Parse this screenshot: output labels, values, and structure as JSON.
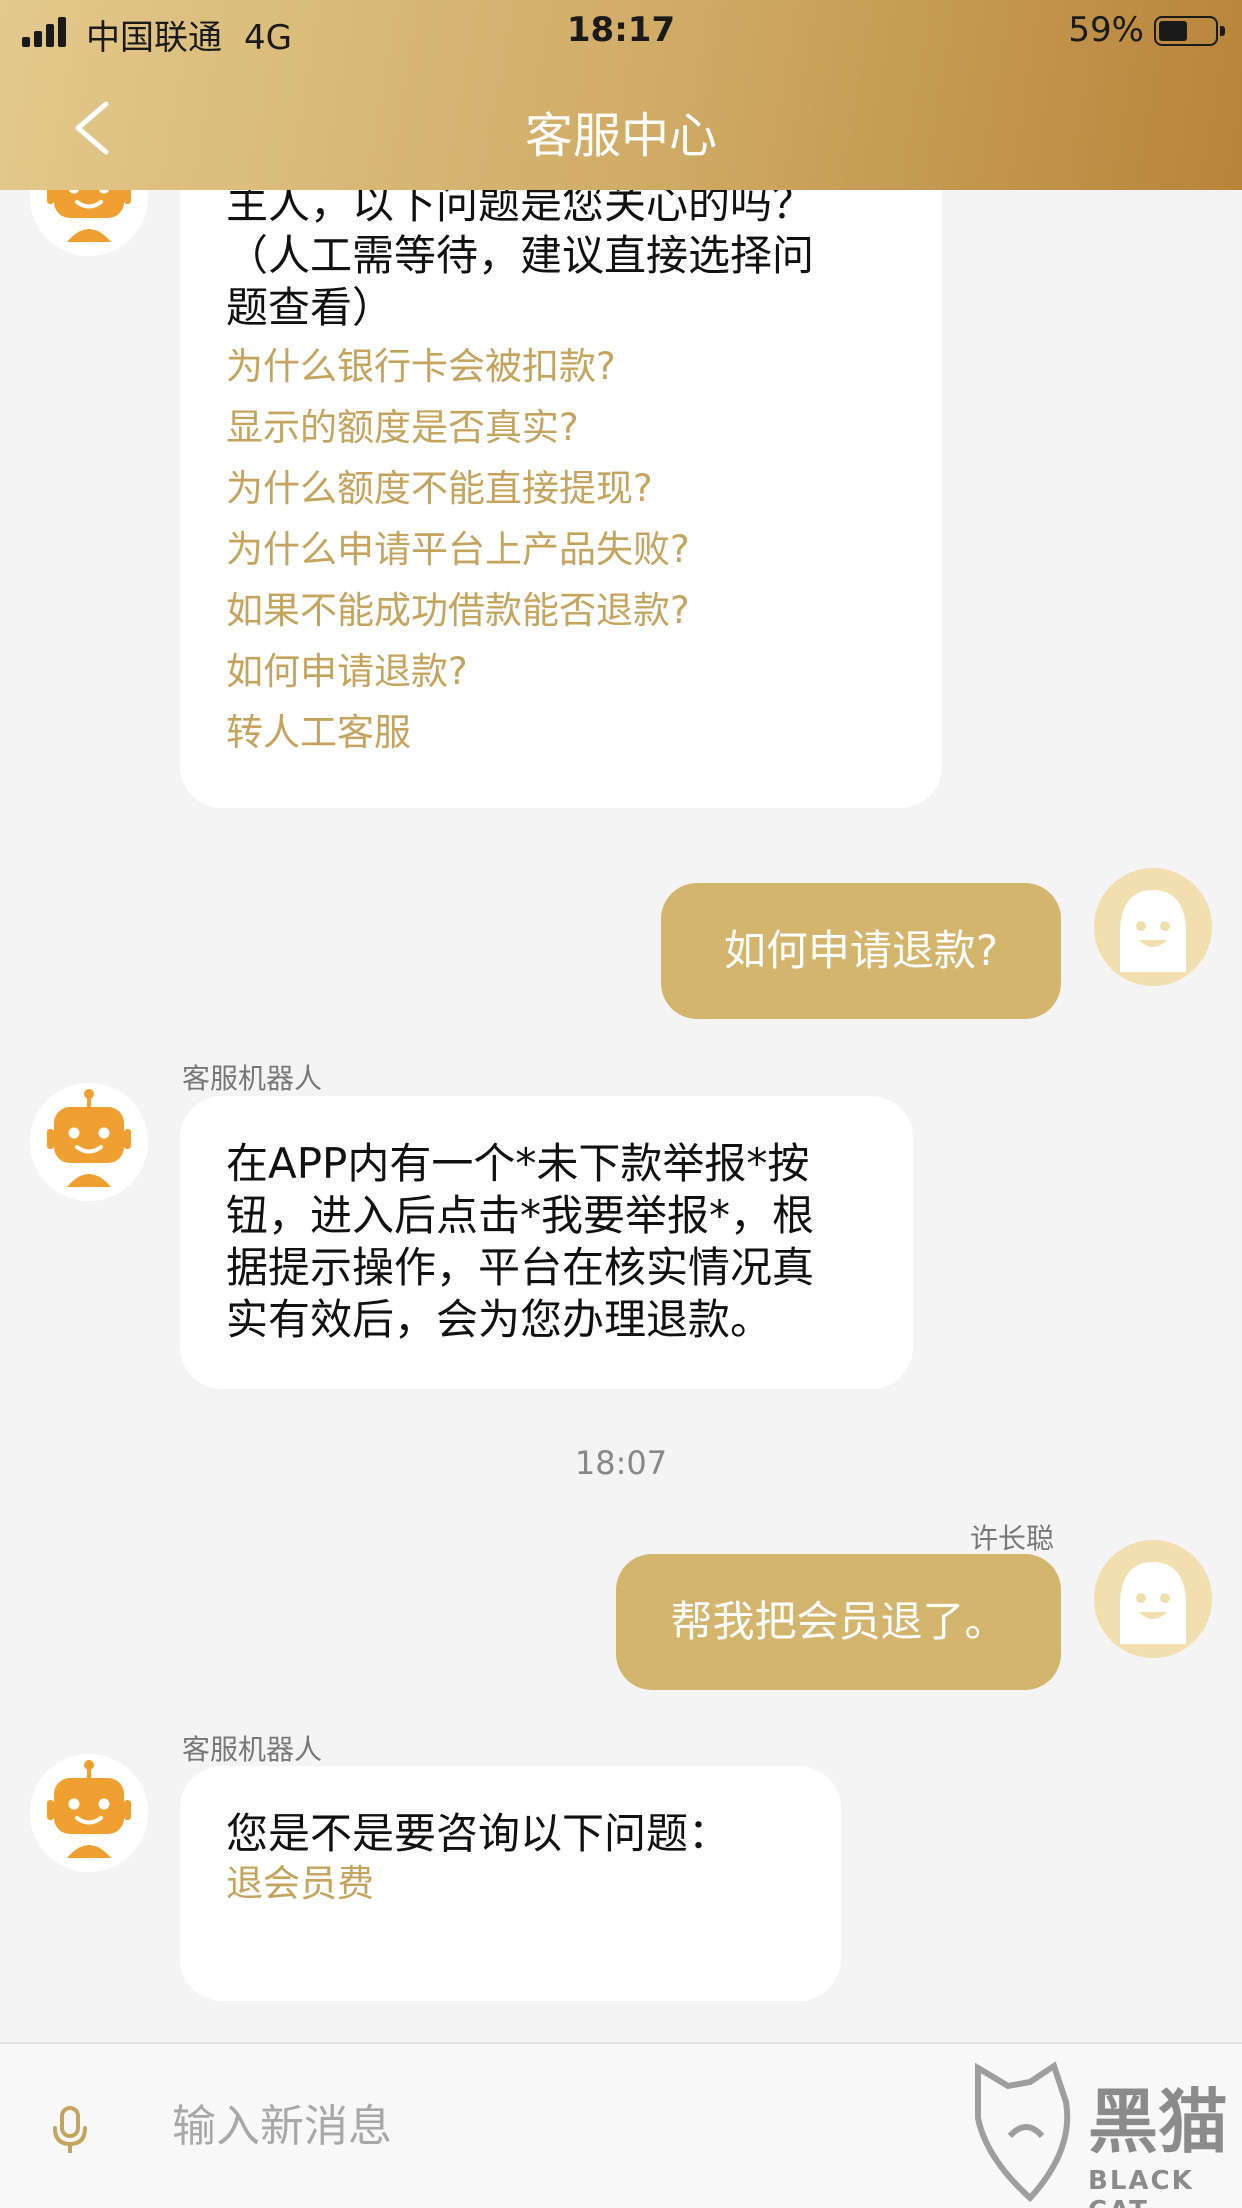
{
  "status_bar": {
    "carrier": "中国联通",
    "network": "4G",
    "time": "18:17",
    "battery": "59%"
  },
  "header": {
    "title": "客服中心"
  },
  "messages": [
    {
      "id": "bot-1",
      "lines": [
        "主人，以下问题是您关心的吗？",
        "（人工需等待，建议直接选择问",
        "题查看）"
      ],
      "links": [
        "为什么银行卡会被扣款?",
        "显示的额度是否真实?",
        "为什么额度不能直接提现?",
        "为什么申请平台上产品失败?",
        "如果不能成功借款能否退款?",
        "如何申请退款?",
        "转人工客服"
      ]
    },
    {
      "id": "user-1",
      "text": "如何申请退款?"
    },
    {
      "id": "bot-2",
      "sender": "客服机器人",
      "lines": [
        "在APP内有一个*未下款举报*按",
        "钮，进入后点击*我要举报*，根",
        "据提示操作，平台在核实情况真",
        "实有效后，会为您办理退款。"
      ]
    },
    {
      "id": "time-1",
      "text": "18:07"
    },
    {
      "id": "user-2",
      "sender": "许长聪",
      "text": "帮我把会员退了。"
    },
    {
      "id": "bot-3",
      "sender": "客服机器人",
      "lines": [
        "您是不是要咨询以下问题："
      ],
      "links": [
        "退会员费"
      ]
    }
  ],
  "input": {
    "placeholder": "输入新消息"
  },
  "watermark": {
    "brand": "黑猫",
    "brand_en": "BLACK CAT"
  },
  "colors": {
    "accent": "#d4b56e",
    "header_start": "#e3c98c",
    "header_end": "#b8843a",
    "link": "#c5a45e",
    "background": "#f4f4f4"
  }
}
